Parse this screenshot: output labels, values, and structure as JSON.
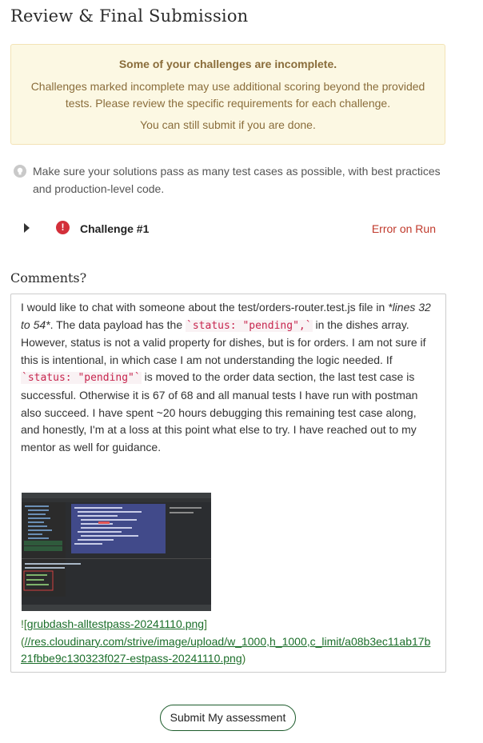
{
  "page": {
    "title": "Review & Final Submission"
  },
  "alert": {
    "heading": "Some of your challenges are incomplete.",
    "body": "Challenges marked incomplete may use additional scoring beyond the provided tests. Please review the specific requirements for each challenge.",
    "footer": "You can still submit if you are done."
  },
  "tip": {
    "icon": "lightbulb-icon",
    "text": "Make sure your solutions pass as many test cases as possible, with best practices and production-level code."
  },
  "challenge": {
    "name": "Challenge #1",
    "status": "Error on Run",
    "status_icon": "!",
    "status_color": "#d32f3a"
  },
  "comments": {
    "label": "Comments?",
    "p1_a": "I would like to chat with someone about the test/orders-router.test.js file in ",
    "p1_em": "*lines 32 to 54*",
    "p1_b": ".  The data payload has the ",
    "code1": "`status: \"pending\",`",
    "p1_c": " in the dishes array.  However, status is not a valid property for dishes, but is for orders.  I am not sure if this is intentional, in which case I am not understanding the logic needed.  If ",
    "code2": "`status: \"pending\"`",
    "p1_d": " is moved to the order data section, the last test case is successful.  Otherwise it is 67 of 68 and all manual tests I have run with postman also succeed.  I have spent ~20 hours debugging this remaining test case along, and honestly, I'm at a loss at this point what else to try.  I have reached out to my mentor as well for guidance.",
    "image_alt": "grubdash-alltestpass-20241110.png",
    "link_prefix": "![",
    "link_text": "grubdash-alltestpass-20241110.png",
    "link_suffix": "]",
    "url_prefix": "(",
    "url_text": "//res.cloudinary.com/strive/image/upload/w_1000,h_1000,c_limit/a08b3ec11ab17b21fbbe9c130323f027-estpass-20241110.png",
    "url_suffix": ")"
  },
  "submit": {
    "label": "Submit My assessment"
  }
}
